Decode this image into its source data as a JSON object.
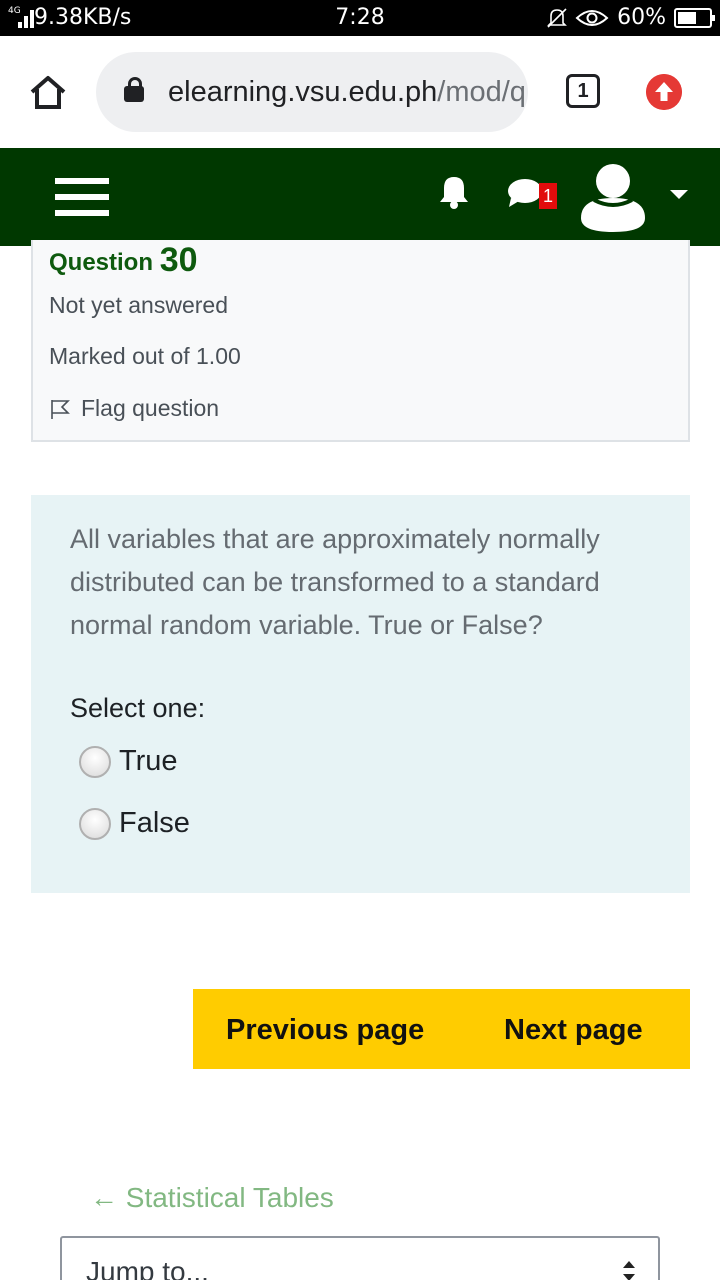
{
  "status_bar": {
    "network_type": "4G",
    "speed": "9.38KB/s",
    "time": "7:28",
    "battery": "60%",
    "battery_level": 0.6
  },
  "browser": {
    "url_domain": "elearning.vsu.edu.ph",
    "url_path": "/mod/q",
    "tab_count": "1"
  },
  "navbar": {
    "message_badge": "1",
    "background": "#003800"
  },
  "question_info": {
    "title": "Question",
    "number": "30",
    "state": "Not yet answered",
    "mark": "Marked out of 1.00",
    "flag_label": "Flag question"
  },
  "question": {
    "text": "All variables that are approximately normally distributed can be transformed to a standard normal random variable. True or False?",
    "prompt": "Select one:",
    "options": [
      {
        "label": "True",
        "selected": false
      },
      {
        "label": "False",
        "selected": false
      }
    ]
  },
  "navigation": {
    "previous_label": "Previous page",
    "next_label": "Next page",
    "accent": "#ffcc00"
  },
  "footer": {
    "prev_activity": "← Statistical Tables",
    "jump_to": "Jump to..."
  }
}
